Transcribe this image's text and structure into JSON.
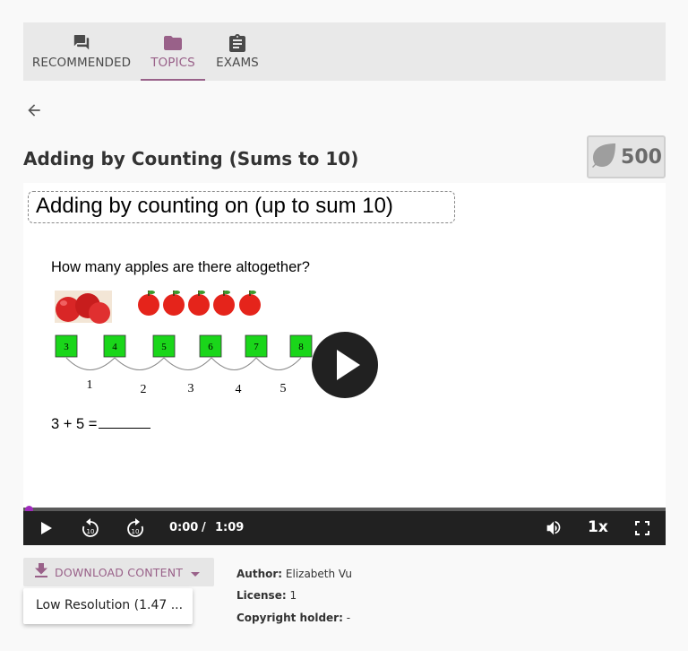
{
  "nav": {
    "tabs": [
      {
        "label": "RECOMMENDED",
        "icon": "forum-icon",
        "active": false
      },
      {
        "label": "TOPICS",
        "icon": "folder-icon",
        "active": true
      },
      {
        "label": "EXAMS",
        "icon": "clipboard-icon",
        "active": false
      }
    ]
  },
  "page": {
    "title": "Adding by Counting (Sums to 10)",
    "points": "500"
  },
  "video": {
    "frame_heading": "Adding by counting on (up to sum 10)",
    "frame_question": "How many apples are there altogether?",
    "boxes": [
      "3",
      "4",
      "5",
      "6",
      "7",
      "8"
    ],
    "arc_numbers": [
      "1",
      "2",
      "3",
      "4",
      "5"
    ],
    "equation": "3 + 5 =",
    "current_time": "0:00",
    "separator": "/",
    "duration": "1:09",
    "rate": "1x",
    "progress": 0
  },
  "download": {
    "button_label": "DOWNLOAD CONTENT",
    "menu_item": "Low Resolution (1.47 ..."
  },
  "meta": {
    "author_label": "Author:",
    "author": "Elizabeth Vu",
    "license_label": "License:",
    "license": "1",
    "copyright_label": "Copyright holder:",
    "copyright": "-"
  },
  "colors": {
    "accent": "#996189",
    "nav_bg": "#e9e9e9",
    "player_bar": "#212121",
    "progress_knob": "#a02bbd",
    "box_green": "#1ad61a"
  }
}
